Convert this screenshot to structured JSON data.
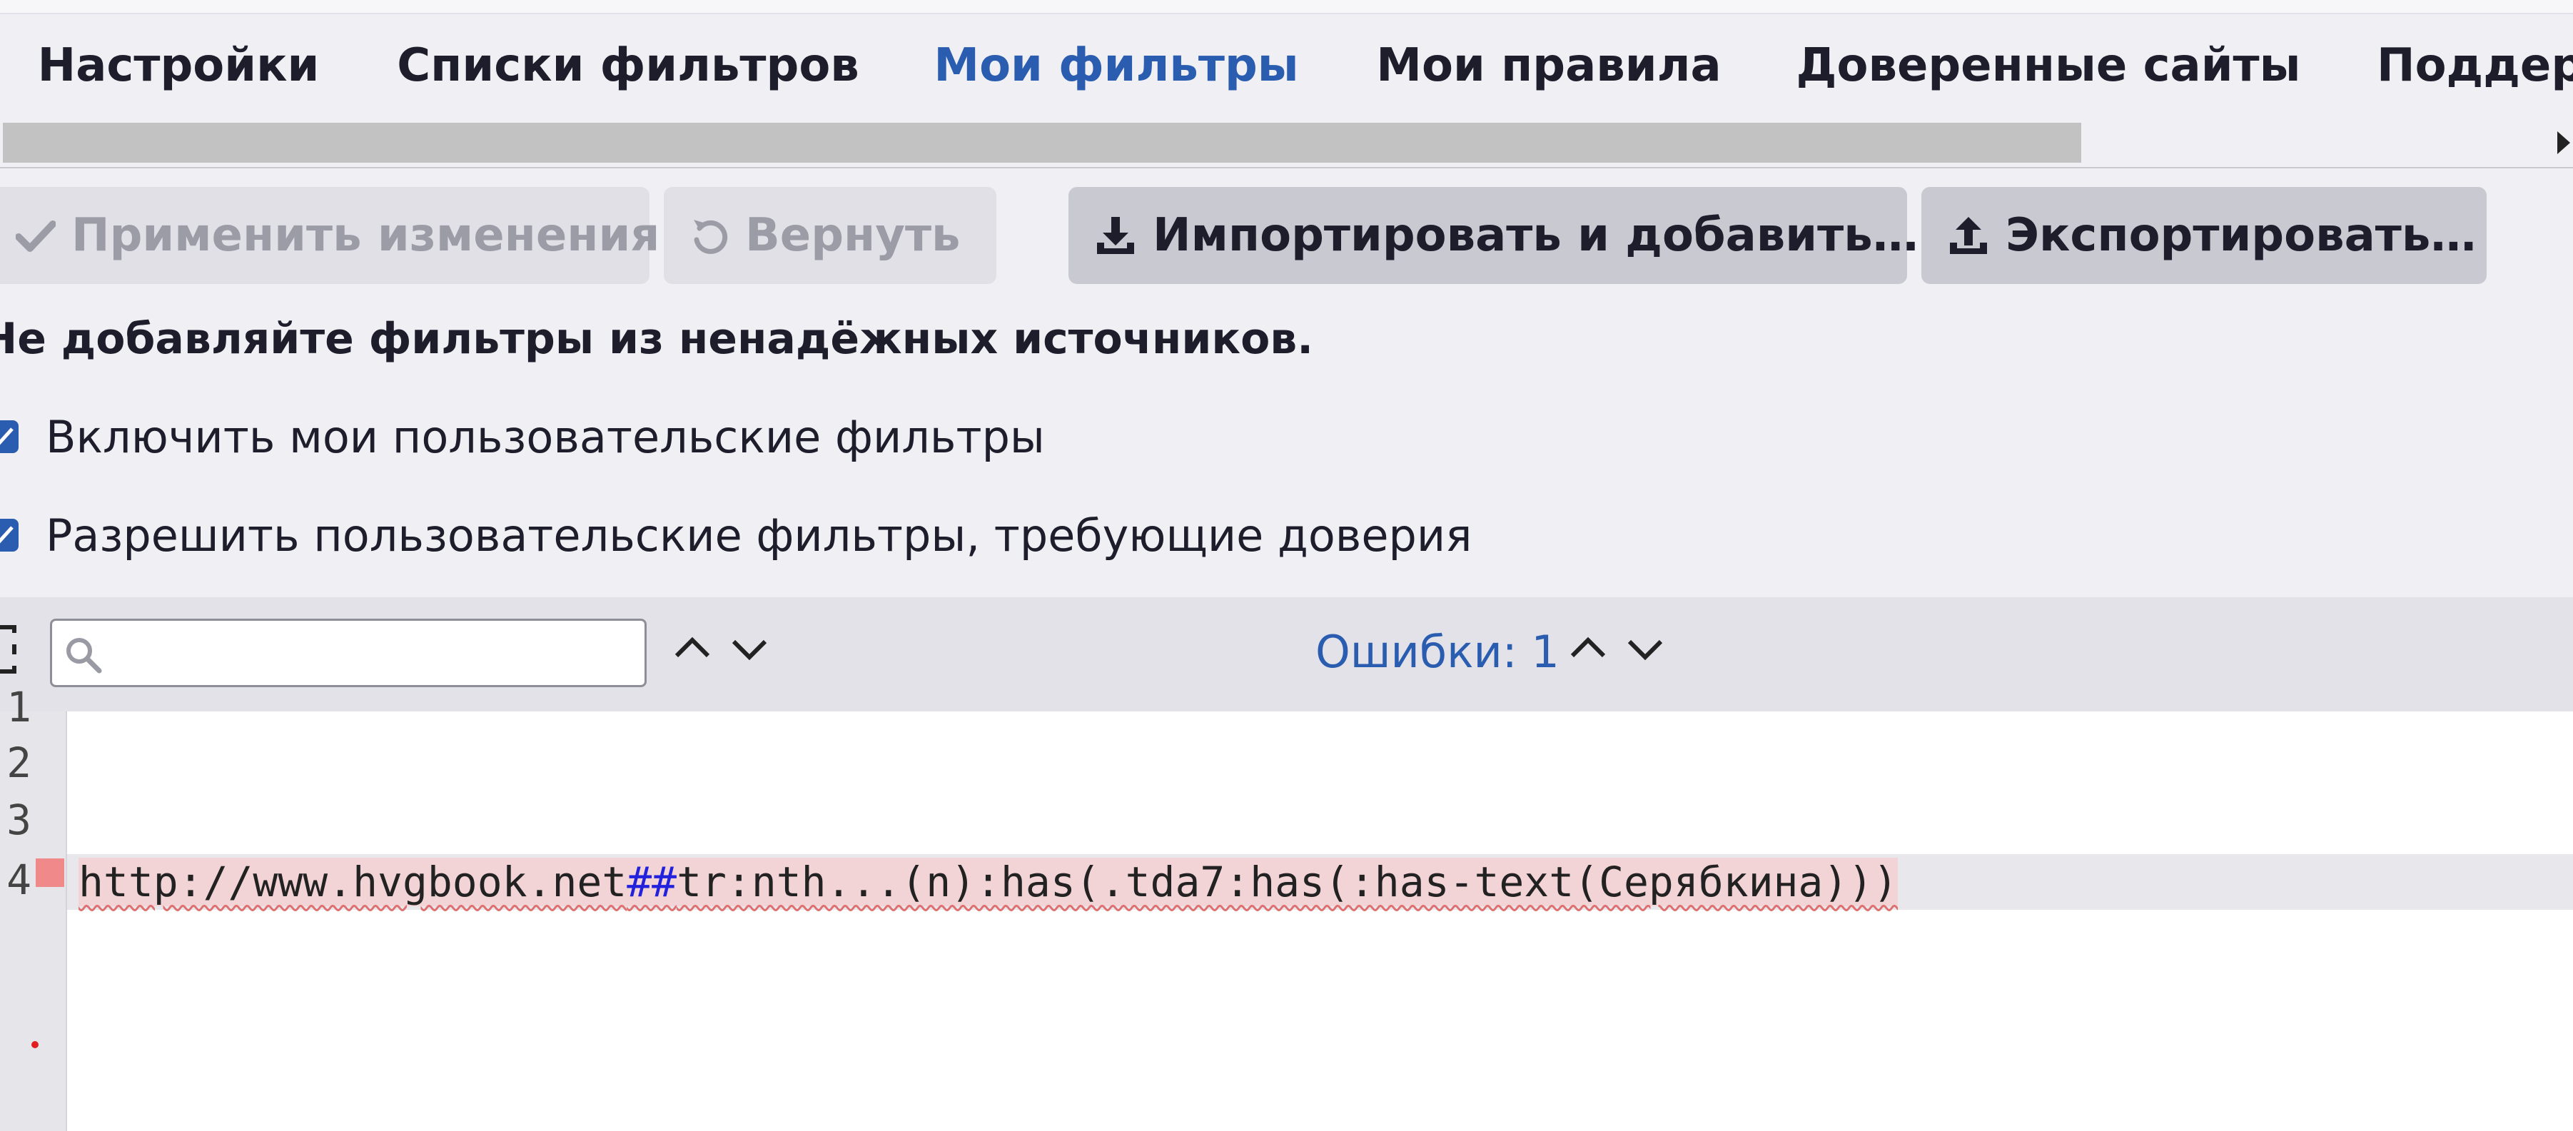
{
  "tabs": [
    {
      "label": "Настройки",
      "active": false
    },
    {
      "label": "Списки фильтров",
      "active": false
    },
    {
      "label": "Мои фильтры",
      "active": true
    },
    {
      "label": "Мои правила",
      "active": false
    },
    {
      "label": "Доверенные сайты",
      "active": false
    },
    {
      "label": "Поддер",
      "active": false
    }
  ],
  "toolbar": {
    "apply_label": "Применить изменения",
    "revert_label": "Вернуть",
    "import_label": "Импортировать и добавить…",
    "export_label": "Экспортировать…"
  },
  "warning": "Не добавляйте фильтры из ненадёжных источников.",
  "options": [
    {
      "label": "Включить мои пользовательские фильтры",
      "checked": true
    },
    {
      "label": "Разрешить пользовательские фильтры, требующие доверия",
      "checked": true
    }
  ],
  "editor": {
    "search_placeholder": "",
    "errors_label": "Ошибки: 1",
    "line_numbers": [
      "1",
      "2",
      "3",
      "4"
    ],
    "code": {
      "domain": "http://www.hvgbook.net",
      "separator": "##",
      "selector": "tr:nth...(n):has(.tda7:has(:has-text(Серябкина)))"
    }
  },
  "colors": {
    "accent": "#2a5db0",
    "error_marker": "#f08a8a",
    "error_highlight": "#f2d3d6"
  }
}
